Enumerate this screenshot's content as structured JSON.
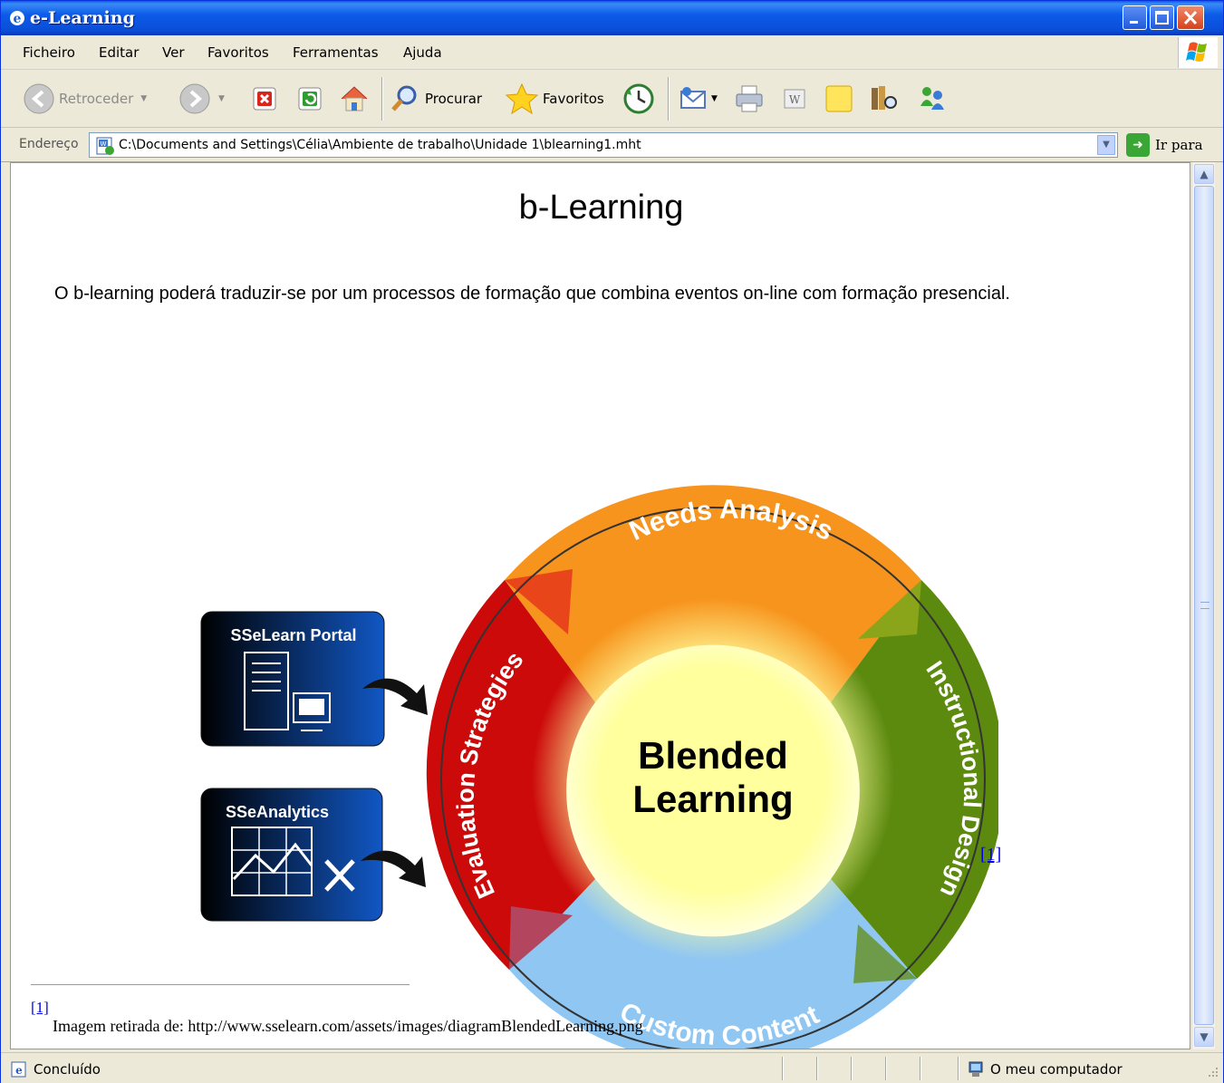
{
  "window": {
    "title": "e-Learning"
  },
  "menu": {
    "items": [
      "Ficheiro",
      "Editar",
      "Ver",
      "Favoritos",
      "Ferramentas",
      "Ajuda"
    ]
  },
  "toolbar": {
    "back_label": "Retroceder",
    "search_label": "Procurar",
    "favorites_label": "Favoritos"
  },
  "address": {
    "label": "Endereço",
    "value": "C:\\Documents and Settings\\Célia\\Ambiente de trabalho\\Unidade 1\\blearning1.mht",
    "go_label": "Ir para"
  },
  "page": {
    "title": "b-Learning",
    "intro": "O b-learning poderá traduzir-se por um processos de formação que combina eventos on-line com formação presencial.",
    "footnote_ref": "[1]",
    "footnote_num": "[1]",
    "footnote_text": "Imagem retirada de: http://www.sselearn.com/assets/images/diagramBlendedLearning.png"
  },
  "diagram": {
    "center_line1": "Blended",
    "center_line2": "Learning",
    "segment_top": "Needs Analysis",
    "segment_right": "Instructional Design",
    "segment_bottom": "Custom  Content",
    "segment_left": "Evaluation Strategies",
    "box_portal": "SSeLearn Portal",
    "box_analytics": "SSeAnalytics",
    "colors": {
      "top": "#f7941d",
      "right": "#5c8a0f",
      "bottom": "#8fc6f2",
      "left": "#cc0a0a",
      "center": "#ffff99"
    }
  },
  "status": {
    "text": "Concluído",
    "zone": "O meu computador"
  }
}
